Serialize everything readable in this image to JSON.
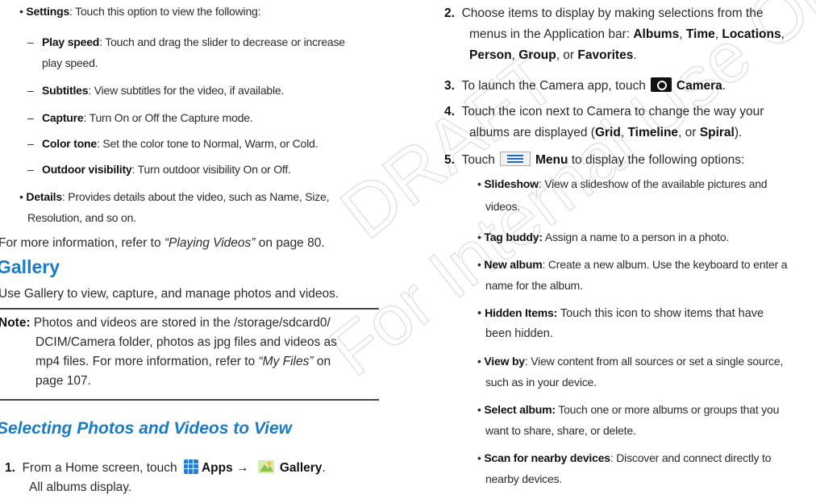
{
  "left": {
    "settings": {
      "term": "Settings",
      "text": ": Touch this option to view the following:"
    },
    "play_speed": {
      "term": "Play speed",
      "text": ": Touch and drag the slider to decrease or increase",
      "cont": "play speed."
    },
    "subtitles": {
      "term": "Subtitles",
      "text": ": View subtitles for the video, if available."
    },
    "capture": {
      "term": "Capture",
      "text": ": Turn On or Off the Capture mode."
    },
    "color_tone": {
      "term": "Color tone",
      "text": ": Set the color tone to Normal, Warm, or Cold."
    },
    "outdoor": {
      "term": "Outdoor visibility",
      "text": ": Turn outdoor visibility On or Off."
    },
    "details": {
      "term": "Details",
      "text": ": Provides details about the video, such as Name, Size,",
      "cont": "Resolution, and so on."
    },
    "more_info": {
      "pre": "For more information, refer to ",
      "ref": "“Playing Videos”",
      "post": " on page 80."
    },
    "gallery_heading": "Gallery",
    "gallery_intro": "Use Gallery to view, capture, and manage photos and videos.",
    "note": {
      "label": "Note:",
      "line1": " Photos and videos are stored in the /storage/sdcard0/",
      "line2": "DCIM/Camera folder, photos as jpg files and videos as",
      "line3_pre": "mp4 files. For more information, refer to ",
      "line3_ref": "“My Files”",
      "line3_post": " on",
      "line4": "page 107."
    },
    "selecting_heading": "Selecting Photos and Videos to View",
    "step1": {
      "num": "1.",
      "pre": "From a Home screen, touch",
      "apps": "Apps",
      "arrow": "→",
      "gallery": "Gallery",
      "end": ".",
      "cont": "All albums display."
    }
  },
  "right": {
    "step2": {
      "num": "2.",
      "line1": "Choose items to display by making selections from the",
      "line2_pre": "menus in the Application bar: ",
      "albums": "Albums",
      "c1": ", ",
      "time": "Time",
      "c2": ", ",
      "locations": "Locations",
      "c3": ",",
      "person": "Person",
      "c4": ", ",
      "group": "Group",
      "c5": ", or ",
      "favorites": "Favorites",
      "end": "."
    },
    "step3": {
      "num": "3.",
      "pre": "To launch the Camera app, touch",
      "camera": "Camera",
      "end": "."
    },
    "step4": {
      "num": "4.",
      "line1": "Touch the icon next to Camera to change the way your",
      "line2_pre": "albums are displayed (",
      "grid": "Grid",
      "c1": ", ",
      "timeline": "Timeline",
      "c2": ", or ",
      "spiral": "Spiral",
      "end": ")."
    },
    "step5": {
      "num": "5.",
      "pre": "Touch",
      "menu": "Menu",
      "post": " to display the following options:"
    },
    "slideshow": {
      "term": "Slideshow",
      "text": ": View a slideshow of the available pictures and",
      "cont": "videos."
    },
    "tag_buddy": {
      "term": "Tag buddy:",
      "text": " Assign a name to a person in a photo."
    },
    "new_album": {
      "term": "New album",
      "text": ": Create a new album. Use the keyboard to enter a",
      "cont": "name for the album."
    },
    "hidden_items": {
      "term": "Hidden Items:",
      "text": "  Touch this icon to show items that have",
      "cont": "been hidden."
    },
    "view_by": {
      "term": "View by",
      "text": ": View content from all sources or set a single source,",
      "cont": "such as in your device."
    },
    "select_album": {
      "term": "Select album:",
      "text": " Touch one or more albums or groups that you",
      "cont": "want to share, share, or delete."
    },
    "scan": {
      "term": "Scan for nearby devices",
      "text": ": Discover and connect directly to",
      "cont": "nearby devices."
    }
  },
  "watermark": {
    "line1": "DRAFT",
    "line2": "For Internal Use Only"
  }
}
